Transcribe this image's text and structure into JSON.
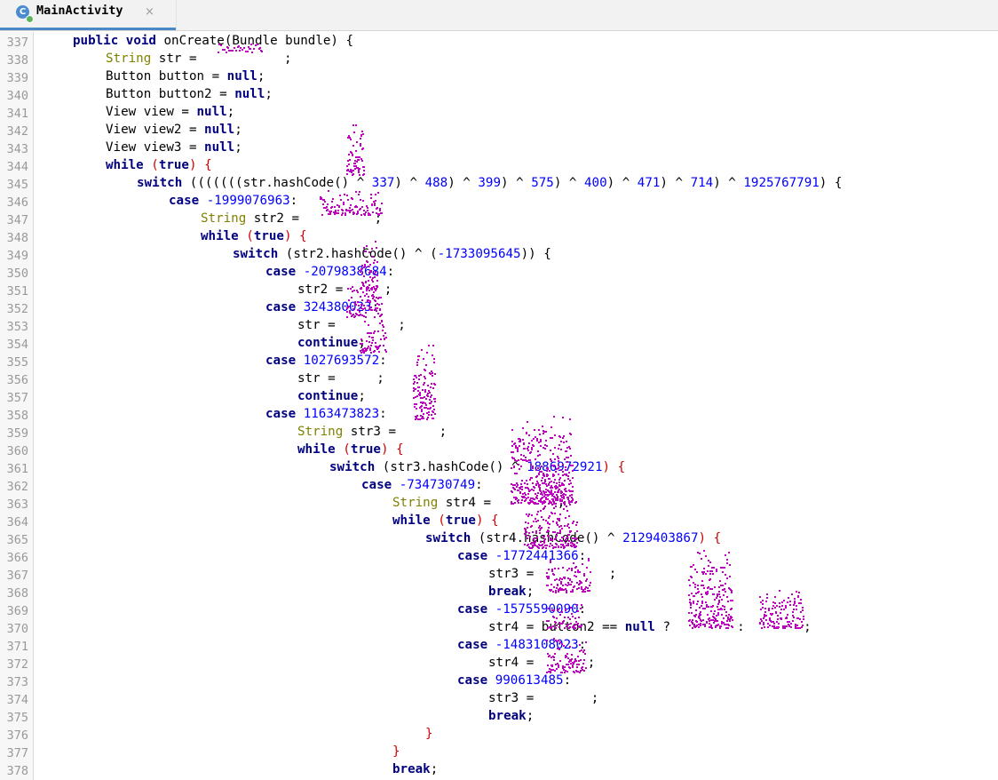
{
  "tab": {
    "title": "MainActivity",
    "icon_letter": "C",
    "close_glyph": "×"
  },
  "colors": {
    "keyword": "#000080",
    "number": "#0000ff",
    "string": "#008000",
    "junk": "#c000c0",
    "brace": "#d00000"
  },
  "line_numbers": [
    "337",
    "338",
    "339",
    "340",
    "341",
    "342",
    "343",
    "344",
    "345",
    "346",
    "347",
    "348",
    "349",
    "350",
    "351",
    "352",
    "353",
    "354",
    "355",
    "356",
    "357",
    "358",
    "359",
    "360",
    "361",
    "362",
    "363",
    "364",
    "365",
    "366",
    "367",
    "368",
    "369",
    "370",
    "371",
    "372",
    "373",
    "374",
    "375",
    "376",
    "377",
    "378"
  ],
  "code": {
    "l337": {
      "kw1": "public void",
      "rest": " onCreate(Bundle bundle) {"
    },
    "l338": {
      "kw": "String",
      "rest": " str = ",
      "tail": ";"
    },
    "l339": {
      "text": "Button button = ",
      "kw": "null",
      "tail": ";"
    },
    "l340": {
      "text": "Button button2 = ",
      "kw": "null",
      "tail": ";"
    },
    "l341": {
      "text": "View view = ",
      "kw": "null",
      "tail": ";"
    },
    "l342": {
      "text": "View view2 = ",
      "kw": "null",
      "tail": ";"
    },
    "l343": {
      "text": "View view3 = ",
      "kw": "null",
      "tail": ";"
    },
    "l344": {
      "kw1": "while",
      "mid": " (",
      "kw2": "true",
      "tail": ") {"
    },
    "l345": {
      "kw": "switch",
      "rest": " (((((((str.hashCode() ^ ",
      "n1": "337",
      "r1": ") ^ ",
      "n2": "488",
      "r2": ") ^ ",
      "n3": "399",
      "r3": ") ^ ",
      "n4": "575",
      "r4": ") ^ ",
      "n5": "400",
      "r5": ") ^ ",
      "n6": "471",
      "r6": ") ^ ",
      "n7": "714",
      "r7": ") ^ ",
      "n8": "1925767791",
      "r8": ") {"
    },
    "l346": {
      "kw": "case",
      "num": " -1999076963",
      "tail": ":"
    },
    "l347": {
      "kw": "String",
      "rest": " str2 = ",
      "tail": ";"
    },
    "l348": {
      "kw1": "while",
      "mid": " (",
      "kw2": "true",
      "tail": ") {"
    },
    "l349": {
      "kw": "switch",
      "rest": " (str2.hashCode() ^ (",
      "num": "-1733095645",
      "tail": ")) {"
    },
    "l350": {
      "kw": "case",
      "num": " -2079838684",
      "tail": ":"
    },
    "l351": {
      "text": "str2 = ",
      "tail": ";"
    },
    "l352": {
      "kw": "case",
      "num": " 324380023",
      "tail": ":"
    },
    "l353": {
      "text": "str = ",
      "tail": ";"
    },
    "l354": {
      "kw": "continue",
      "tail": ";"
    },
    "l355": {
      "kw": "case",
      "num": " 1027693572",
      "tail": ":"
    },
    "l356": {
      "text": "str = ",
      "tail": ";"
    },
    "l357": {
      "kw": "continue",
      "tail": ";"
    },
    "l358": {
      "kw": "case",
      "num": " 1163473823",
      "tail": ":"
    },
    "l359": {
      "kw": "String",
      "rest": " str3 = ",
      "tail": ";"
    },
    "l360": {
      "kw1": "while",
      "mid": " (",
      "kw2": "true",
      "tail": ") {"
    },
    "l361": {
      "kw": "switch",
      "rest": " (str3.hashCode() ^ ",
      "num": "1886972921",
      "tail": ") {"
    },
    "l362": {
      "kw": "case",
      "num": " -734730749",
      "tail": ":"
    },
    "l363": {
      "kw": "String",
      "rest": " str4 = ",
      "tail": ";"
    },
    "l364": {
      "kw1": "while",
      "mid": " (",
      "kw2": "true",
      "tail": ") {"
    },
    "l365": {
      "kw": "switch",
      "rest": " (str4.hashCode() ^ ",
      "num": "2129403867",
      "tail": ") {"
    },
    "l366": {
      "kw": "case",
      "num": " -1772441366",
      "tail": ":"
    },
    "l367": {
      "text": "str3 = ",
      "tail": ";"
    },
    "l368": {
      "kw": "break",
      "tail": ";"
    },
    "l369": {
      "kw": "case",
      "num": " -1575590090",
      "tail": ":"
    },
    "l370": {
      "text": "str4 = button2 == ",
      "kw": "null",
      "mid": " ? ",
      "mid2": " : ",
      "tail": ";"
    },
    "l371": {
      "kw": "case",
      "num": " -1483108023",
      "tail": ":"
    },
    "l372": {
      "text": "str4 = ",
      "tail": ";"
    },
    "l373": {
      "kw": "case",
      "num": " 990613485",
      "tail": ":"
    },
    "l374": {
      "text": "str3 = ",
      "tail": ";"
    },
    "l375": {
      "kw": "break",
      "tail": ";"
    },
    "l376": {
      "text": "}"
    },
    "l377": {
      "text": "}"
    },
    "l378": {
      "kw": "break",
      "tail": ";"
    }
  }
}
